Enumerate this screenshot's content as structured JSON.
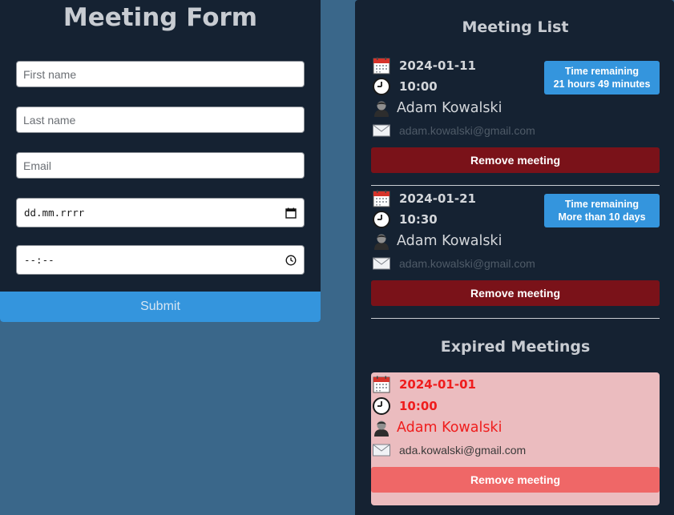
{
  "form": {
    "title": "Meeting Form",
    "first_name_placeholder": "First name",
    "last_name_placeholder": "Last name",
    "email_placeholder": "Email",
    "date_placeholder": "dd.mm.rrrr",
    "time_placeholder": "--:--",
    "submit_label": "Submit"
  },
  "meeting_list": {
    "heading": "Meeting List",
    "meetings": [
      {
        "date": "2024-01-11",
        "time": "10:00",
        "name": "Adam Kowalski",
        "email": "adam.kowalski@gmail.com",
        "badge_title": "Time remaining",
        "badge_value": "21 hours 49 minutes",
        "remove_label": "Remove meeting"
      },
      {
        "date": "2024-01-21",
        "time": "10:30",
        "name": "Adam Kowalski",
        "email": "adam.kowalski@gmail.com",
        "badge_title": "Time remaining",
        "badge_value": "More than 10 days",
        "remove_label": "Remove meeting"
      }
    ]
  },
  "expired": {
    "heading": "Expired Meetings",
    "meetings": [
      {
        "date": "2024-01-01",
        "time": "10:00",
        "name": "Adam Kowalski",
        "email": "ada.kowalski@gmail.com",
        "remove_label": "Remove meeting"
      }
    ]
  },
  "icons": {
    "date": "calendar-icon",
    "time": "clock-icon",
    "name": "person-icon",
    "email": "envelope-icon",
    "date_picker": "calendar-picker-icon",
    "time_picker": "clock-picker-icon"
  },
  "colors": {
    "background": "#3a678a",
    "panel": "#152232",
    "accent": "#3495dd",
    "remove": "#7a1219",
    "expired_card": "#ebbcbf",
    "expired_text": "#ef1d1d",
    "expired_remove": "#ef6767"
  }
}
